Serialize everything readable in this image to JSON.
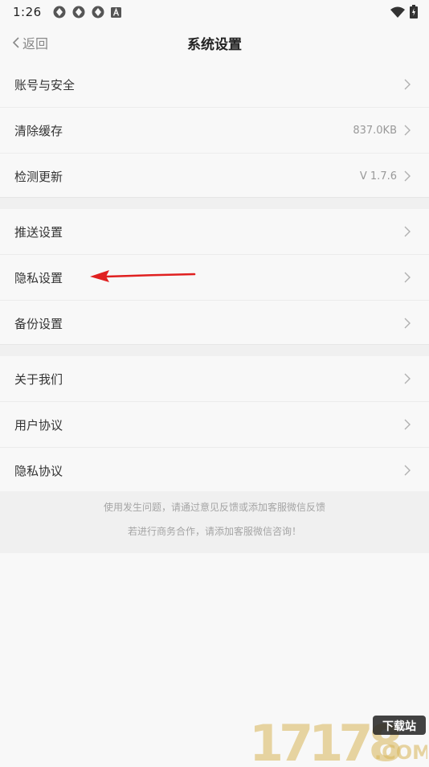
{
  "status_bar": {
    "time": "1:26",
    "left_icons": [
      "sync-icon",
      "sync-icon",
      "sync-icon",
      "a-badge-icon"
    ],
    "right_icons": [
      "wifi-icon",
      "battery-icon"
    ]
  },
  "nav": {
    "back_label": "返回",
    "title": "系统设置"
  },
  "groups": [
    {
      "items": [
        {
          "label": "账号与安全",
          "value": ""
        },
        {
          "label": "清除缓存",
          "value": "837.0KB"
        },
        {
          "label": "检测更新",
          "value": "V 1.7.6"
        }
      ]
    },
    {
      "items": [
        {
          "label": "推送设置",
          "value": ""
        },
        {
          "label": "隐私设置",
          "value": ""
        },
        {
          "label": "备份设置",
          "value": ""
        }
      ]
    },
    {
      "items": [
        {
          "label": "关于我们",
          "value": ""
        },
        {
          "label": "用户协议",
          "value": ""
        },
        {
          "label": "隐私协议",
          "value": ""
        }
      ]
    }
  ],
  "footer": {
    "line1": "使用发生问题，请通过意见反馈或添加客服微信反馈",
    "line2": "若进行商务合作，请添加客服微信咨询！"
  },
  "watermark": {
    "number": "17178",
    "tag": "下载站",
    "domain": ".COM"
  },
  "colors": {
    "background": "#f8f8f8",
    "separator": "#f0f0f0",
    "annotation_arrow": "#e02020",
    "watermark_gold": "#d9b65a"
  }
}
